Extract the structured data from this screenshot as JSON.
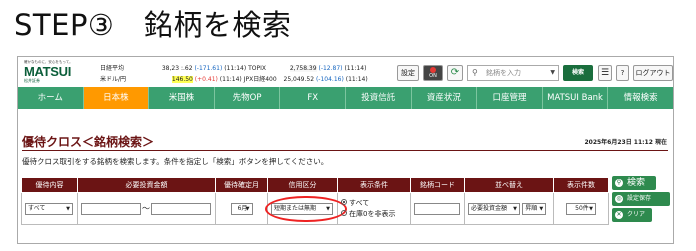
{
  "step_title": "STEP③　銘柄を検索",
  "header": {
    "logo": {
      "tagline": "確かなものに、安心をもって。",
      "brand": "MATSUI",
      "sub": "松井証券"
    },
    "markets": [
      {
        "name": "日経平均",
        "value": "38,23 :.62",
        "change": "(-171.61)",
        "time": "(11:14)",
        "name2": "TOPIX",
        "value2": "2,758.39",
        "change2": "(-12.87)",
        "time2": "(11:14)"
      },
      {
        "name": "米ドル/円",
        "value": "146.50",
        "change": "(+0.41)",
        "time": "(11:14)",
        "name2": "JPX日経400",
        "value2": "25,049.52",
        "change2": "(-104.16)",
        "time2": "(11:14)"
      }
    ],
    "config_label": "設定",
    "on_label": "ON",
    "refresh_icon": "refresh-icon",
    "stock_input_placeholder": "銘柄を入力",
    "search_label": "検索",
    "help_label": "?",
    "logout_label": "ログアウト"
  },
  "nav": {
    "items": [
      {
        "label": "ホーム",
        "active": false
      },
      {
        "label": "日本株",
        "active": true
      },
      {
        "label": "米国株",
        "active": false
      },
      {
        "label": "先物OP",
        "active": false
      },
      {
        "label": "FX",
        "active": false
      },
      {
        "label": "投資信託",
        "active": false
      },
      {
        "label": "資産状況",
        "active": false
      },
      {
        "label": "口座管理",
        "active": false
      },
      {
        "label": "MATSUI Bank",
        "active": false
      },
      {
        "label": "情報検索",
        "active": false
      }
    ]
  },
  "page": {
    "title": "優待クロス＜銘柄検索＞",
    "datetime": "2025年6月23日 11:12 現在",
    "description": "優待クロス取引をする銘柄を検索します。条件を指定し「検索」ボタンを押してください。"
  },
  "conditions": {
    "headers": [
      "優待内容",
      "必要投資金額",
      "優待確定月",
      "信用区分",
      "表示条件",
      "銘柄コード",
      "並べ替え",
      "表示件数"
    ],
    "benefit_content": "すべて",
    "investment_min": "",
    "investment_sep": "〜",
    "investment_max": "",
    "confirm_month": "6月",
    "credit_type": "短期または無期",
    "display_options": [
      {
        "label": "すべて",
        "selected": true
      },
      {
        "label": "在庫0を非表示",
        "selected": false
      }
    ],
    "stock_code": "",
    "sort_key": "必要投資金額",
    "sort_order": "昇順",
    "count": "50件"
  },
  "side_buttons": {
    "search": "検索",
    "save": "設定保存",
    "clear": "クリア"
  },
  "colors": {
    "nav_green": "#3aa070",
    "nav_active": "#ff9900",
    "header_maroon": "#6b1414",
    "button_green": "#2e8a4e",
    "highlight_ring": "#ee2222"
  }
}
